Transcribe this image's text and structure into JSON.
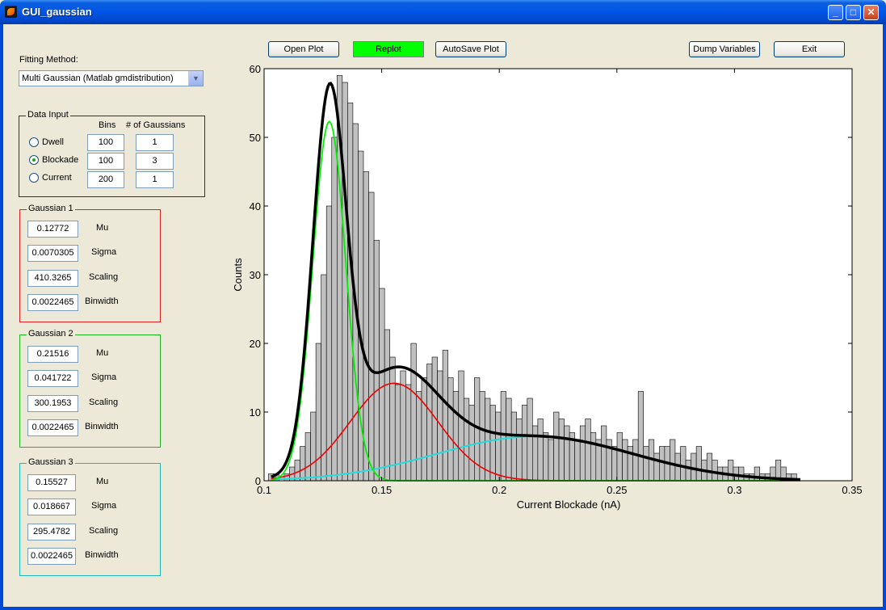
{
  "window": {
    "title": "GUI_gaussian",
    "min_label": "_",
    "max_label": "□",
    "close_label": "✕"
  },
  "toolbar": {
    "open_plot": "Open Plot",
    "replot": "Replot",
    "autosave_plot": "AutoSave Plot",
    "dump_variables": "Dump Variables",
    "exit": "Exit"
  },
  "fitting": {
    "label": "Fitting Method:",
    "selected": "Multi Gaussian (Matlab gmdistribution)"
  },
  "data_input": {
    "title": "Data Input",
    "col_bins": "Bins",
    "col_gaussians": "# of Gaussians",
    "rows": [
      {
        "label": "Dwell",
        "bins": "100",
        "gaussians": "1",
        "selected": false
      },
      {
        "label": "Blockade",
        "bins": "100",
        "gaussians": "3",
        "selected": true
      },
      {
        "label": "Current",
        "bins": "200",
        "gaussians": "1",
        "selected": false
      }
    ]
  },
  "gaussians": [
    {
      "title": "Gaussian 1",
      "color": "#d42020",
      "mu": "0.12772",
      "sigma": "0.0070305",
      "scaling": "410.3265",
      "binwidth": "0.0022465"
    },
    {
      "title": "Gaussian 2",
      "color": "#22b522",
      "mu": "0.21516",
      "sigma": "0.041722",
      "scaling": "300.1953",
      "binwidth": "0.0022465"
    },
    {
      "title": "Gaussian 3",
      "color": "#22b5b5",
      "mu": "0.15527",
      "sigma": "0.018667",
      "scaling": "295.4782",
      "binwidth": "0.0022465"
    }
  ],
  "param_labels": {
    "mu": "Mu",
    "sigma": "Sigma",
    "scaling": "Scaling",
    "binwidth": "Binwidth"
  },
  "chart_data": {
    "type": "bar",
    "xlabel": "Current Blockade (nA)",
    "ylabel": "Counts",
    "xlim": [
      0.1,
      0.35
    ],
    "ylim": [
      0,
      60
    ],
    "xticks": [
      "0.1",
      "0.15",
      "0.2",
      "0.25",
      "0.3",
      "0.35"
    ],
    "yticks": [
      "0",
      "10",
      "20",
      "30",
      "40",
      "50",
      "60"
    ],
    "grid": false,
    "bar_color": "#c0c0c0",
    "curve_colors": {
      "total": "#000000",
      "g_green": "#00ee00",
      "g_red": "#ee0000",
      "g_cyan": "#22dddd"
    },
    "bin_width": 0.0022465,
    "bin_start": 0.1018,
    "counts": [
      1,
      1,
      0,
      1,
      2,
      3,
      5,
      7,
      10,
      20,
      30,
      40,
      50,
      59,
      58,
      55,
      52,
      48,
      45,
      42,
      35,
      28,
      22,
      18,
      14,
      16,
      14,
      20,
      13,
      15,
      17,
      18,
      16,
      19,
      15,
      13,
      16,
      12,
      11,
      15,
      13,
      12,
      11,
      10,
      13,
      12,
      10,
      9,
      11,
      12,
      8,
      9,
      7,
      6,
      10,
      9,
      8,
      7,
      6,
      8,
      9,
      7,
      6,
      8,
      6,
      5,
      7,
      6,
      5,
      6,
      13,
      5,
      6,
      4,
      5,
      5,
      6,
      4,
      5,
      3,
      4,
      5,
      3,
      4,
      3,
      2,
      2,
      3,
      2,
      2,
      1,
      1,
      2,
      1,
      1,
      2,
      3,
      2,
      1,
      1
    ]
  }
}
